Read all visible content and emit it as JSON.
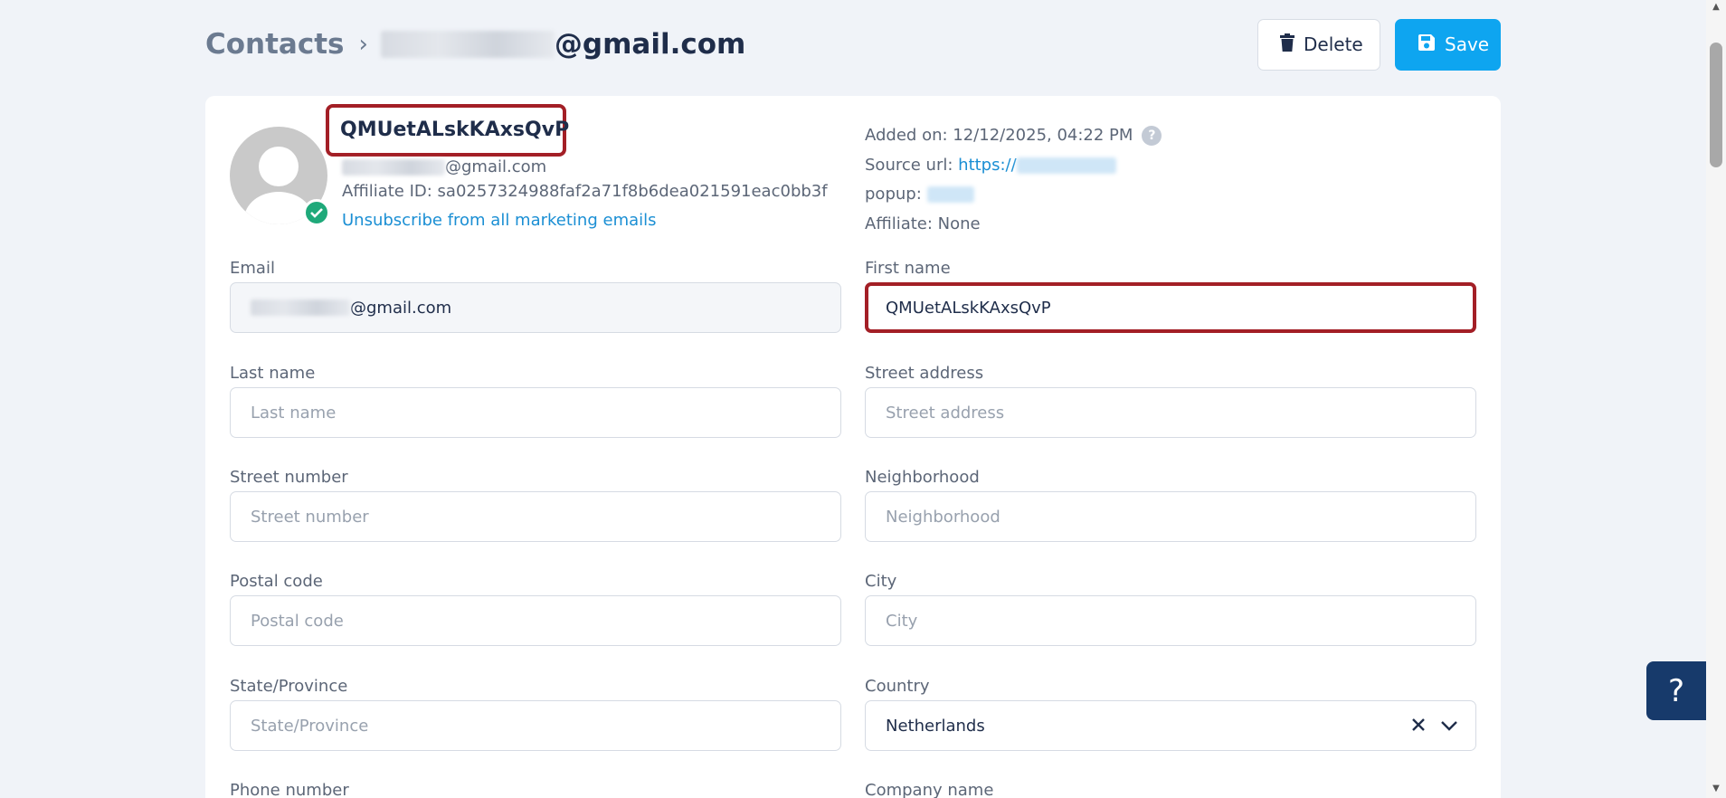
{
  "breadcrumb": {
    "root": "Contacts",
    "separator": "›",
    "current_suffix": "@gmail.com"
  },
  "actions": {
    "delete_label": "Delete",
    "save_label": "Save"
  },
  "contact": {
    "name": "QMUetALskKAxsQvP",
    "email_suffix": "@gmail.com",
    "affiliate_id": "Affiliate ID: sa0257324988faf2a71f8b6dea021591eac0bb3f",
    "unsubscribe_label": "Unsubscribe from all marketing emails"
  },
  "meta": {
    "added_on": "Added on: 12/12/2025, 04:22 PM",
    "source_url_label": "Source url:",
    "source_url_value": "https://",
    "popup_label": "popup:",
    "affiliate": "Affiliate: None"
  },
  "fields": {
    "email": {
      "label": "Email",
      "value": "@gmail.com"
    },
    "first_name": {
      "label": "First name",
      "value": "QMUetALskKAxsQvP"
    },
    "last_name": {
      "label": "Last name",
      "placeholder": "Last name"
    },
    "street_address": {
      "label": "Street address",
      "placeholder": "Street address"
    },
    "street_number": {
      "label": "Street number",
      "placeholder": "Street number"
    },
    "neighborhood": {
      "label": "Neighborhood",
      "placeholder": "Neighborhood"
    },
    "postal_code": {
      "label": "Postal code",
      "placeholder": "Postal code"
    },
    "city": {
      "label": "City",
      "placeholder": "City"
    },
    "state": {
      "label": "State/Province",
      "placeholder": "State/Province"
    },
    "country": {
      "label": "Country",
      "value": "Netherlands"
    },
    "phone": {
      "label": "Phone number"
    },
    "company": {
      "label": "Company name"
    }
  },
  "help": {
    "label": "?"
  },
  "icons": {
    "delete": "trash-icon",
    "save": "floppy-disk-icon",
    "verified": "check-circle-icon",
    "info": "question-circle-icon",
    "clear": "close-icon",
    "dropdown": "chevron-down-icon"
  },
  "colors": {
    "primary": "#0ea5f0",
    "highlight": "#a31f26",
    "link": "#1b8fd4",
    "verified": "#1fa97a",
    "help_bg": "#173a6b"
  }
}
